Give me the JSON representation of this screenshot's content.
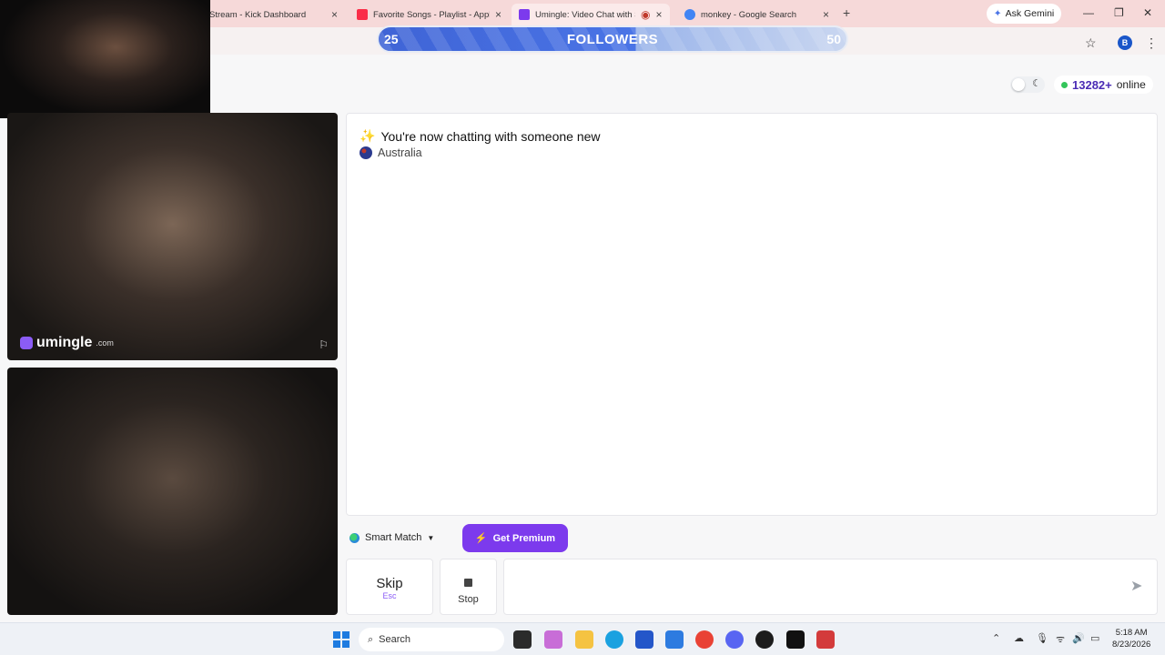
{
  "browser": {
    "tabs": [
      {
        "title": "Stream - Kick Dashboard",
        "favicon_color": "#53fc18"
      },
      {
        "title": "Favorite Songs - Playlist - Apple",
        "favicon_color": "#fa2d48"
      },
      {
        "title": "Umingle: Video Chat with St",
        "favicon_color": "#7c3aed"
      },
      {
        "title": "monkey - Google Search",
        "favicon_color": "#4285f4"
      }
    ],
    "ask_gemini": "Ask Gemini",
    "profile_initial": "B"
  },
  "followers_goal": {
    "current": "25",
    "label": "FOLLOWERS",
    "target": "50",
    "progress_fraction": 0.5
  },
  "online": {
    "count": "13282+",
    "label": "online"
  },
  "video": {
    "brand_name": "umingle",
    "brand_domain": ".com"
  },
  "chat": {
    "status_message": "You're now chatting with someone new",
    "country": "Australia"
  },
  "controls": {
    "smart_match": "Smart Match",
    "premium": "Get Premium",
    "skip": "Skip",
    "skip_hint": "Esc",
    "stop": "Stop",
    "message_value": ""
  },
  "taskbar": {
    "search_placeholder": "Search",
    "time": "5:18 AM",
    "date": "8/23/2026"
  },
  "colors": {
    "accent": "#7c3aed",
    "online_dot": "#34c55a",
    "followers_bar": "#3f64d6"
  }
}
